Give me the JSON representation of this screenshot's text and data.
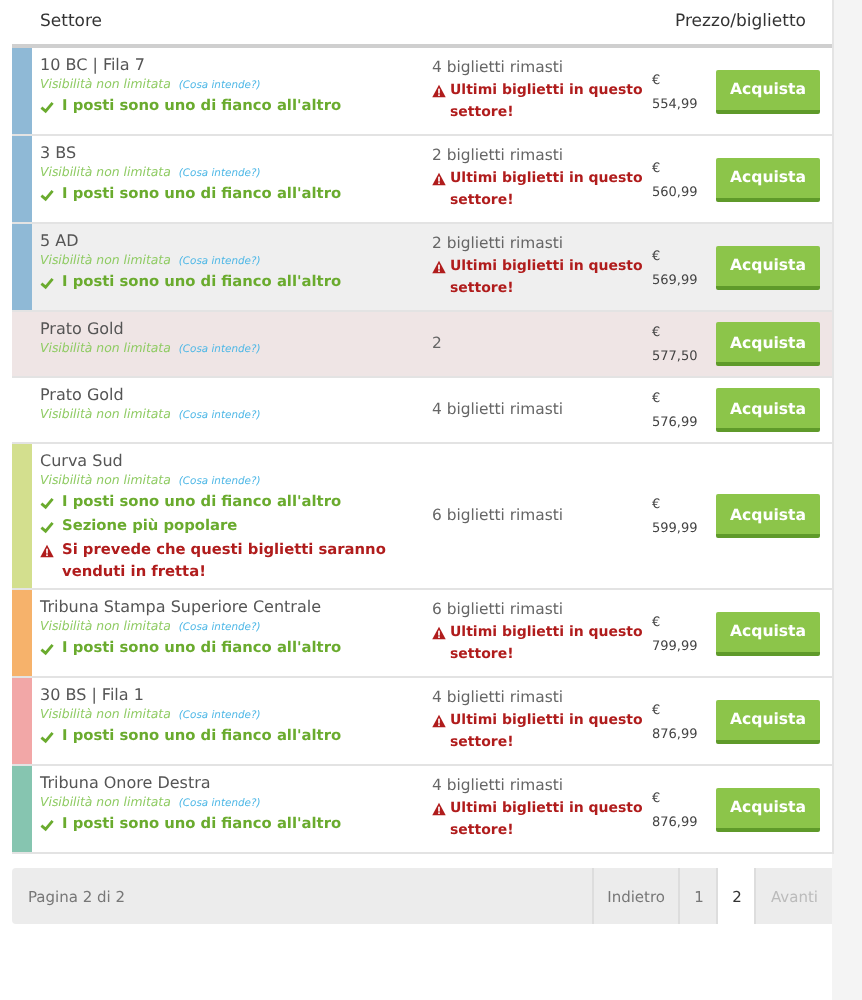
{
  "table": {
    "columns": [
      "Settore",
      "Prezzo/biglietto"
    ],
    "rows": [
      {
        "name": "10 BC | Fila 7",
        "color": "#8fb9d6",
        "kind": "plain",
        "visibility": "Visibilità non limitata",
        "info_link": "(Cosa intende?)",
        "features": [
          {
            "kind": "check",
            "text": "I posti sono uno di fianco all'altro"
          }
        ],
        "remaining": "4 biglietti rimasti",
        "warning": "Ultimi biglietti in questo settore!",
        "currency": "€",
        "price": "554,99",
        "button": "Acquista"
      },
      {
        "name": "3 BS",
        "color": "#8fb9d6",
        "kind": "plain",
        "visibility": "Visibilità non limitata",
        "info_link": "(Cosa intende?)",
        "features": [
          {
            "kind": "check",
            "text": "I posti sono uno di fianco all'altro"
          }
        ],
        "remaining": "2 biglietti rimasti",
        "warning": "Ultimi biglietti in questo settore!",
        "currency": "€",
        "price": "560,99",
        "button": "Acquista"
      },
      {
        "name": "5 AD",
        "color": "#8fb9d6",
        "kind": "hover",
        "visibility": "Visibilità non limitata",
        "info_link": "(Cosa intende?)",
        "features": [
          {
            "kind": "check",
            "text": "I posti sono uno di fianco all'altro"
          }
        ],
        "remaining": "2 biglietti rimasti",
        "warning": "Ultimi biglietti in questo settore!",
        "currency": "€",
        "price": "569,99",
        "button": "Acquista"
      },
      {
        "name": "Prato Gold",
        "kind": "marked",
        "visibility": "Visibilità non limitata",
        "info_link": "(Cosa intende?)",
        "features": [],
        "remaining": "2",
        "currency": "€",
        "price": "577,50",
        "button": "Acquista"
      },
      {
        "name": "Prato Gold",
        "kind": "plain",
        "visibility": "Visibilità non limitata",
        "info_link": "(Cosa intende?)",
        "features": [],
        "remaining": "4 biglietti rimasti",
        "currency": "€",
        "price": "576,99",
        "button": "Acquista"
      },
      {
        "name": "Curva Sud",
        "color": "#d3df8e",
        "kind": "plain",
        "visibility": "Visibilità non limitata",
        "info_link": "(Cosa intende?)",
        "features": [
          {
            "kind": "check",
            "text": "I posti sono uno di fianco all'altro"
          },
          {
            "kind": "check",
            "text": "Sezione più popolare"
          },
          {
            "kind": "warning",
            "text": "Si prevede che questi biglietti saranno venduti in fretta!"
          }
        ],
        "remaining": "6 biglietti rimasti",
        "currency": "€",
        "price": "599,99",
        "button": "Acquista"
      },
      {
        "name": "Tribuna Stampa Superiore Centrale",
        "color": "#f6b26b",
        "kind": "plain",
        "visibility": "Visibilità non limitata",
        "info_link": "(Cosa intende?)",
        "features": [
          {
            "kind": "check",
            "text": "I posti sono uno di fianco all'altro"
          }
        ],
        "remaining": "6 biglietti rimasti",
        "warning": "Ultimi biglietti in questo settore!",
        "currency": "€",
        "price": "799,99",
        "button": "Acquista"
      },
      {
        "name": "30 BS | Fila 1",
        "color": "#f2a7a7",
        "kind": "plain",
        "visibility": "Visibilità non limitata",
        "info_link": "(Cosa intende?)",
        "features": [
          {
            "kind": "check",
            "text": "I posti sono uno di fianco all'altro"
          }
        ],
        "remaining": "4 biglietti rimasti",
        "warning": "Ultimi biglietti in questo settore!",
        "currency": "€",
        "price": "876,99",
        "button": "Acquista"
      },
      {
        "name": "Tribuna Onore Destra",
        "color": "#86c5b0",
        "kind": "plain",
        "visibility": "Visibilità non limitata",
        "info_link": "(Cosa intende?)",
        "features": [
          {
            "kind": "check",
            "text": "I posti sono uno di fianco all'altro"
          }
        ],
        "remaining": "4 biglietti rimasti",
        "warning": "Ultimi biglietti in questo settore!",
        "currency": "€",
        "price": "876,99",
        "button": "Acquista"
      }
    ]
  },
  "pagination": {
    "label": "Pagina 2 di 2",
    "prev": {
      "label": "Indietro",
      "disabled": false
    },
    "pages": [
      {
        "label": "1",
        "selected": false
      },
      {
        "label": "2",
        "selected": true
      }
    ],
    "next": {
      "label": "Avanti",
      "disabled": true
    }
  }
}
